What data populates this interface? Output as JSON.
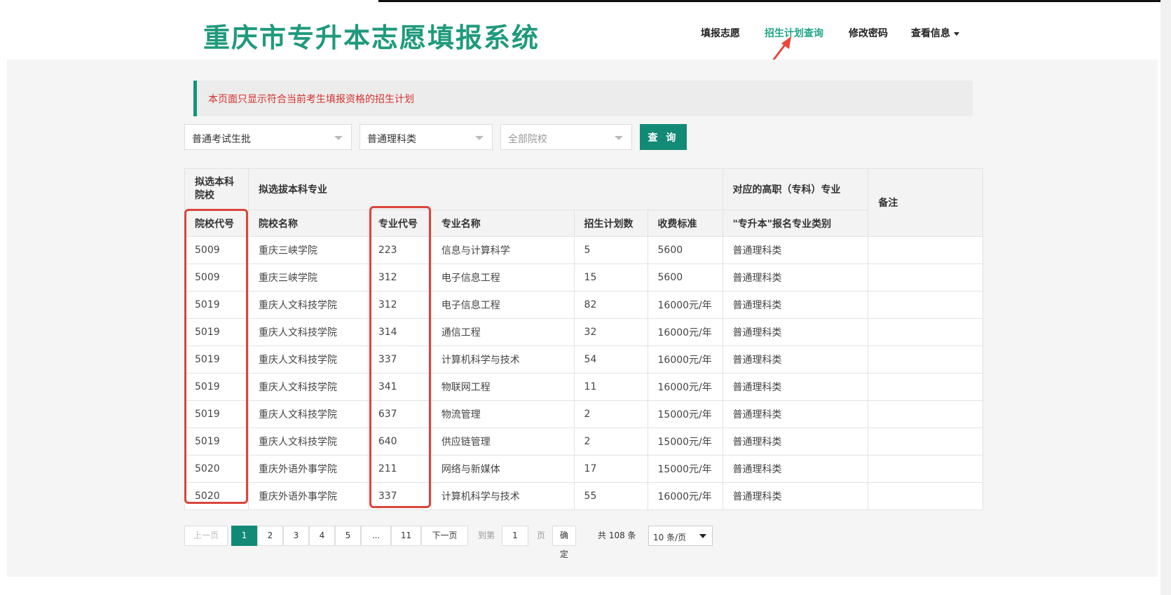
{
  "header": {
    "logo": "重庆市专升本志愿填报系统",
    "nav": [
      {
        "label": "填报志愿"
      },
      {
        "label": "招生计划查询"
      },
      {
        "label": "修改密码"
      },
      {
        "label": "查看信息"
      }
    ]
  },
  "notice": "本页面只显示符合当前考生填报资格的招生计划",
  "filters": {
    "batch": "普通考试生批",
    "category": "普通理科类",
    "school": "全部院校",
    "query_label": "查 询"
  },
  "table": {
    "group_headers": {
      "school": "拟选本科院校",
      "major": "拟选拔本科专业",
      "vocational": "对应的高职（专科）专业",
      "remark": "备注"
    },
    "columns": [
      "院校代号",
      "院校名称",
      "专业代号",
      "专业名称",
      "招生计划数",
      "收费标准",
      "\"专升本\"报名专业类别"
    ],
    "rows": [
      [
        "5009",
        "重庆三峡学院",
        "223",
        "信息与计算科学",
        "5",
        "5600",
        "普通理科类",
        ""
      ],
      [
        "5009",
        "重庆三峡学院",
        "312",
        "电子信息工程",
        "15",
        "5600",
        "普通理科类",
        ""
      ],
      [
        "5019",
        "重庆人文科技学院",
        "312",
        "电子信息工程",
        "82",
        "16000元/年",
        "普通理科类",
        ""
      ],
      [
        "5019",
        "重庆人文科技学院",
        "314",
        "通信工程",
        "32",
        "16000元/年",
        "普通理科类",
        ""
      ],
      [
        "5019",
        "重庆人文科技学院",
        "337",
        "计算机科学与技术",
        "54",
        "16000元/年",
        "普通理科类",
        ""
      ],
      [
        "5019",
        "重庆人文科技学院",
        "341",
        "物联网工程",
        "11",
        "16000元/年",
        "普通理科类",
        ""
      ],
      [
        "5019",
        "重庆人文科技学院",
        "637",
        "物流管理",
        "2",
        "15000元/年",
        "普通理科类",
        ""
      ],
      [
        "5019",
        "重庆人文科技学院",
        "640",
        "供应链管理",
        "2",
        "15000元/年",
        "普通理科类",
        ""
      ],
      [
        "5020",
        "重庆外语外事学院",
        "211",
        "网络与新媒体",
        "17",
        "15000元/年",
        "普通理科类",
        ""
      ],
      [
        "5020",
        "重庆外语外事学院",
        "337",
        "计算机科学与技术",
        "55",
        "16000元/年",
        "普通理科类",
        ""
      ]
    ]
  },
  "pagination": {
    "prev": "上一页",
    "pages": [
      "1",
      "2",
      "3",
      "4",
      "5",
      "...",
      "11"
    ],
    "current": "1",
    "next": "下一页",
    "goto_prefix": "到第",
    "goto_value": "1",
    "goto_suffix": "页",
    "confirm": "确定",
    "total": "共 108 条",
    "page_size": "10 条/页"
  },
  "colors": {
    "brand": "#1f9a7c",
    "active_nav": "#20a587",
    "button": "#138a76",
    "notice_text": "#d2322d",
    "highlight": "#d9463a"
  }
}
